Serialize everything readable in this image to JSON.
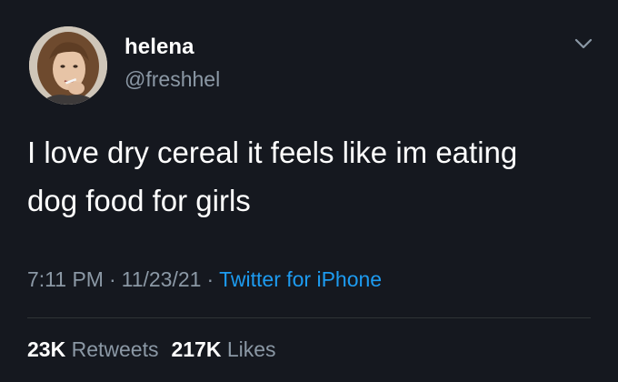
{
  "tweet": {
    "author": {
      "name": "helena",
      "handle": "@freshhel"
    },
    "text_lines": [
      "I love dry cereal it feels like im eating",
      "dog food for girls"
    ],
    "time": "7:11 PM",
    "date": "11/23/21",
    "separator": "·",
    "source": "Twitter for iPhone",
    "stats": {
      "retweets_count": "23K",
      "retweets_label": "Retweets",
      "likes_count": "217K",
      "likes_label": "Likes"
    }
  },
  "icons": {
    "menu": "chevron-down-icon",
    "avatar": "avatar"
  },
  "colors": {
    "background": "#15181f",
    "primary_text": "#ffffff",
    "secondary_text": "#8b98a5",
    "link": "#1d9bf0",
    "divider": "#2f3336"
  }
}
